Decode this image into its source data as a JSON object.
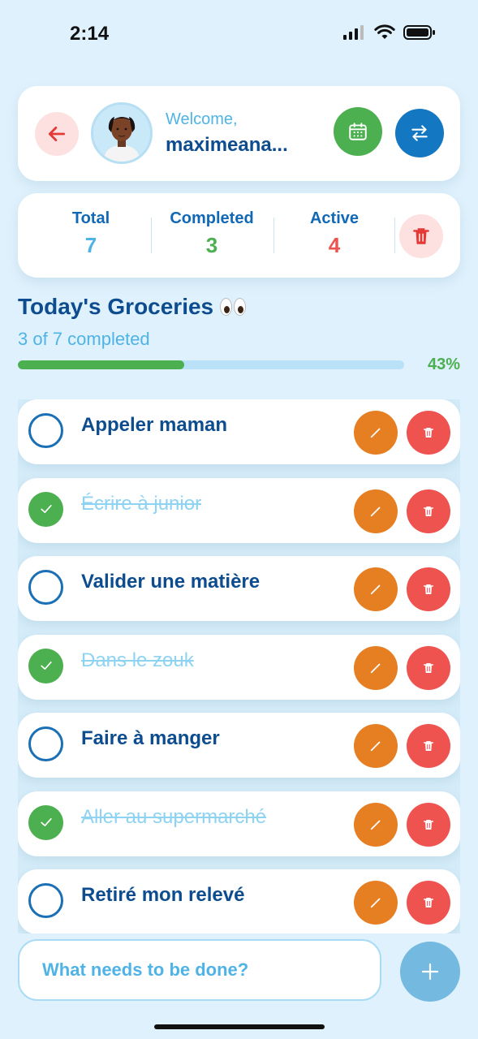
{
  "status_bar": {
    "time": "2:14",
    "icons": [
      "signal-icon",
      "wifi-icon",
      "battery-icon"
    ]
  },
  "header": {
    "welcome": "Welcome,",
    "username": "maximeana...",
    "back_icon": "arrow-left-icon",
    "calendar_icon": "calendar-icon",
    "swap_icon": "swap-arrows-icon"
  },
  "stats": {
    "total_label": "Total",
    "total_value": "7",
    "completed_label": "Completed",
    "completed_value": "3",
    "active_label": "Active",
    "active_value": "4",
    "clear_icon": "trash-icon"
  },
  "list": {
    "title": "Today's Groceries",
    "subtitle": "3 of 7 completed",
    "progress_percent_label": "43%",
    "progress_fraction": 0.43
  },
  "tasks": [
    {
      "text": "Appeler maman",
      "done": false
    },
    {
      "text": "Écrire à junior",
      "done": true
    },
    {
      "text": "Valider une matière",
      "done": false
    },
    {
      "text": "Dans le zouk",
      "done": true
    },
    {
      "text": "Faire à manger",
      "done": false
    },
    {
      "text": "Aller au supermarché",
      "done": true
    },
    {
      "text": "Retiré mon relevé",
      "done": false
    }
  ],
  "composer": {
    "placeholder": "What needs to be done?",
    "add_icon": "plus-icon"
  },
  "colors": {
    "background": "#dff1fc",
    "primary_dark": "#0d4d8f",
    "accent_light": "#4fb3e6",
    "success": "#4caf50",
    "danger": "#ef5350",
    "warning": "#e67e22",
    "blue_button": "#1377c2"
  }
}
